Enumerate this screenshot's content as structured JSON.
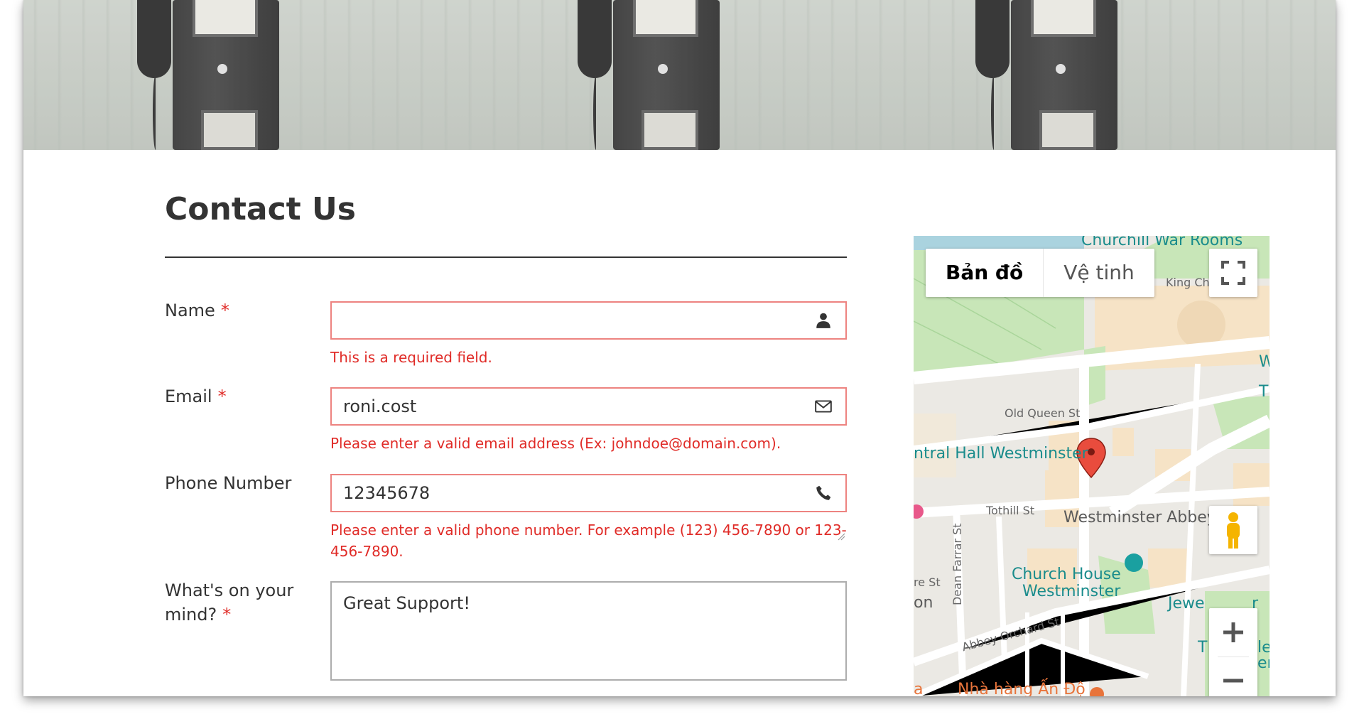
{
  "form": {
    "title": "Contact Us",
    "name": {
      "label": "Name",
      "required_mark": "*",
      "value": "",
      "error": "This is a required field."
    },
    "email": {
      "label": "Email",
      "required_mark": "*",
      "value": "roni.cost",
      "error": "Please enter a valid email address (Ex: johndoe@domain.com)."
    },
    "phone": {
      "label": "Phone Number",
      "value": "12345678",
      "error_line1": "Please enter a valid phone number. For example (123) 456-7890 or 123-",
      "error_line2": "456-7890."
    },
    "message": {
      "label_line1": "What's on your",
      "label_line2": "mind?",
      "required_mark": "*",
      "value": "Great Support!"
    }
  },
  "map": {
    "tabs": [
      "Bản đồ",
      "Vệ tinh"
    ],
    "labels": {
      "churchill": "Churchill War Rooms",
      "king_charles": "King Ch",
      "old_queen": "Old Queen St",
      "central_hall": "ntral Hall Westminster",
      "tothill": "Tothill St",
      "abbey": "Westminster Abbey",
      "dean_farrar": "Dean Farrar St",
      "church_house_1": "Church House",
      "church_house_2": "Westminster",
      "abbey_orchard": "Abbey Orchard St",
      "jewel": "Jewe",
      "restaurant": "Nhà hàng Ấn Độ",
      "edge_w": "W",
      "edge_t": "T",
      "edge_re": "re St",
      "edge_on": "on",
      "edge_le": "le",
      "edge_en": "en",
      "edge_r": "r",
      "edge_t2": "T",
      "edge_a": "a"
    }
  },
  "colors": {
    "error": "#e02b27",
    "input_error_border": "#ed8380",
    "text": "#333333",
    "map_road": "#ffffff",
    "map_park": "#c8e6b8",
    "map_building": "#f6e3c6"
  }
}
